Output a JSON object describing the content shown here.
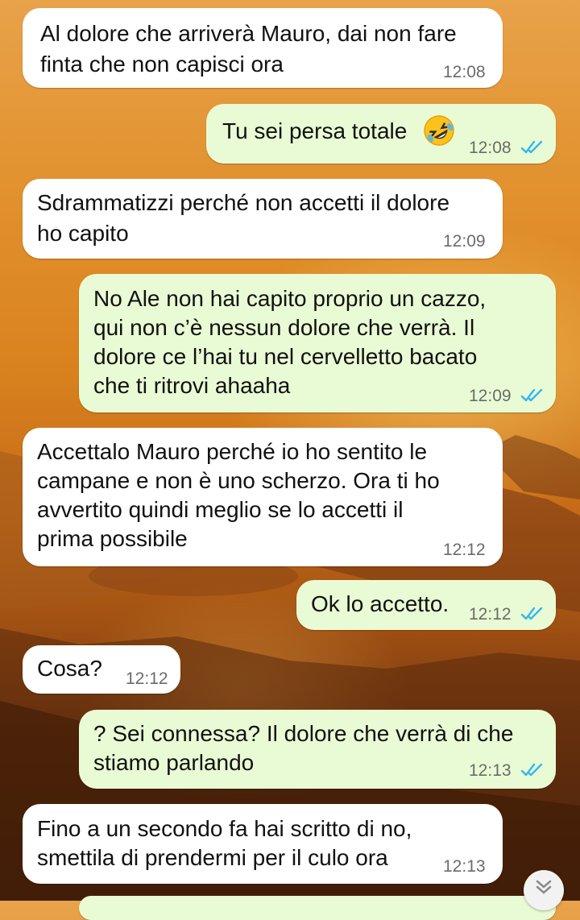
{
  "colors": {
    "incoming_bubble": "#ffffff",
    "outgoing_bubble": "#e9fbd4",
    "read_ticks": "#34b7f1",
    "timestamp": "#6b6b6b"
  },
  "messages": [
    {
      "direction": "in",
      "lines": [
        "Al dolore che arriverà Mauro, dai non fare",
        "finta che non capisci ora"
      ],
      "time": "12:08"
    },
    {
      "direction": "out",
      "lines": [
        "Tu sei persa totale"
      ],
      "emoji": "rolling-on-floor-laughing",
      "time": "12:08",
      "status": "read"
    },
    {
      "direction": "in",
      "lines": [
        "Sdrammatizzi perché non accetti il dolore",
        "ho capito"
      ],
      "time": "12:09"
    },
    {
      "direction": "out",
      "lines": [
        "No Ale non hai capito proprio un cazzo,",
        "qui non c’è nessun dolore che verrà. Il",
        "dolore ce l’hai tu nel cervelletto bacato",
        "che ti ritrovi ahaaha"
      ],
      "time": "12:09",
      "status": "read"
    },
    {
      "direction": "in",
      "lines": [
        "Accettalo Mauro perché io ho sentito le",
        "campane e non è uno scherzo. Ora ti ho",
        "avvertito quindi meglio se lo accetti il",
        "prima possibile"
      ],
      "time": "12:12"
    },
    {
      "direction": "out",
      "lines": [
        "Ok lo accetto."
      ],
      "time": "12:12",
      "status": "read"
    },
    {
      "direction": "in",
      "lines": [
        "Cosa?"
      ],
      "time": "12:12"
    },
    {
      "direction": "out",
      "lines": [
        "? Sei connessa? Il dolore che verrà di che",
        "stiamo parlando"
      ],
      "time": "12:13",
      "status": "read"
    },
    {
      "direction": "in",
      "lines": [
        "Fino a un secondo fa hai scritto di no,",
        "smettila di prendermi per il culo ora"
      ],
      "time": "12:13"
    }
  ],
  "scroll_button": {
    "icon": "chevron-double-down-icon"
  }
}
